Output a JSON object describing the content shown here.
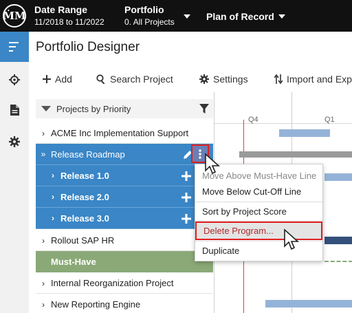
{
  "header": {
    "logo_text": "ṀM",
    "date_range_label": "Date Range",
    "date_range_value": "11/2018 to 11/2022",
    "portfolio_label": "Portfolio",
    "portfolio_value": "0. All Projects",
    "plan_label": "Plan of Record"
  },
  "page_title": "Portfolio Designer",
  "toolbar": {
    "add_label": "Add",
    "search_label": "Search Project",
    "settings_label": "Settings",
    "import_label": "Import and Exp"
  },
  "panel": {
    "title": "Projects by Priority"
  },
  "rows": [
    {
      "label": "ACME Inc Implementation Support"
    },
    {
      "label": "Release Roadmap"
    },
    {
      "label": "Release 1.0"
    },
    {
      "label": "Release 2.0"
    },
    {
      "label": "Release 3.0"
    },
    {
      "label": "Rollout SAP HR"
    },
    {
      "label": "Must-Have"
    },
    {
      "label": "Internal Reorganization Project"
    },
    {
      "label": "New Reporting Engine"
    }
  ],
  "timeline": {
    "quarters": [
      "Q4",
      "Q1"
    ]
  },
  "context_menu": {
    "items": [
      {
        "label": "Move Above Must-Have Line",
        "state": "disabled"
      },
      {
        "label": "Move Below Cut-Off Line",
        "state": "normal"
      },
      {
        "label": "Sort by Project Score",
        "state": "normal"
      },
      {
        "label": "Delete Program...",
        "state": "highlighted"
      },
      {
        "label": "Duplicate",
        "state": "normal"
      }
    ]
  },
  "colors": {
    "topbar": "#111111",
    "accent_blue": "#3a86c6",
    "must_have_green": "#8aa977",
    "highlight_red": "#e02020",
    "bar_blue": "#94b3d8",
    "bar_gray": "#9a9a9a",
    "bar_dark": "#34507a"
  },
  "icons": [
    "logo-icon",
    "menu-lines-icon",
    "target-icon",
    "document-icon",
    "gear-icon",
    "plus-icon",
    "search-icon",
    "settings-gear-icon",
    "import-export-icon",
    "sort-triangle-icon",
    "filter-icon",
    "pencil-icon",
    "kebab-icon",
    "cursor-icon"
  ]
}
